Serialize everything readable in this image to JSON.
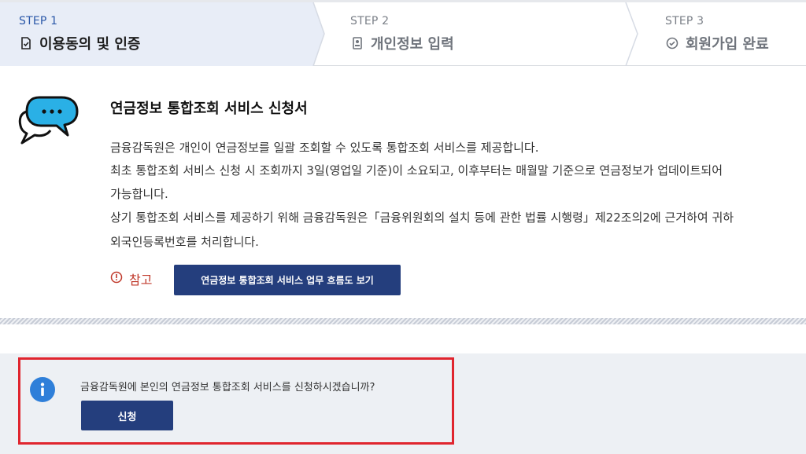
{
  "steps": [
    {
      "num": "STEP 1",
      "title": "이용동의 및 인증",
      "icon": "document-check-icon",
      "active": true
    },
    {
      "num": "STEP 2",
      "title": "개인정보 입력",
      "icon": "id-card-icon",
      "active": false
    },
    {
      "num": "STEP 3",
      "title": "회원가입 완료",
      "icon": "check-circle-icon",
      "active": false
    }
  ],
  "main": {
    "title": "연금정보 통합조회 서비스 신청서",
    "lines": [
      "금융감독원은 개인이 연금정보를 일괄 조회할 수 있도록 통합조회 서비스를 제공합니다.",
      "최초 통합조회 서비스 신청 시 조회까지 3일(영업일 기준)이 소요되고, 이후부터는 매월말 기준으로 연금정보가 업데이트되어",
      "가능합니다.",
      "상기 통합조회 서비스를 제공하기 위해 금융감독원은「금융위원회의 설치 등에 관한 법률 시행령」제22조의2에 근거하여 귀하",
      "외국인등록번호를 처리합니다."
    ],
    "ref_label": "참고",
    "flow_button": "연금정보 통합조회 서비스 업무 흐름도 보기"
  },
  "apply": {
    "question": "금융감독원에 본인의 연금정보 통합조회 서비스를 신청하시겠습니까?",
    "button": "신청"
  },
  "colors": {
    "primary": "#243e7d",
    "active_step_bg": "#e8edf7",
    "highlight": "#e0252e",
    "info_blue": "#2f7fd9",
    "ref_red": "#c0392b"
  }
}
